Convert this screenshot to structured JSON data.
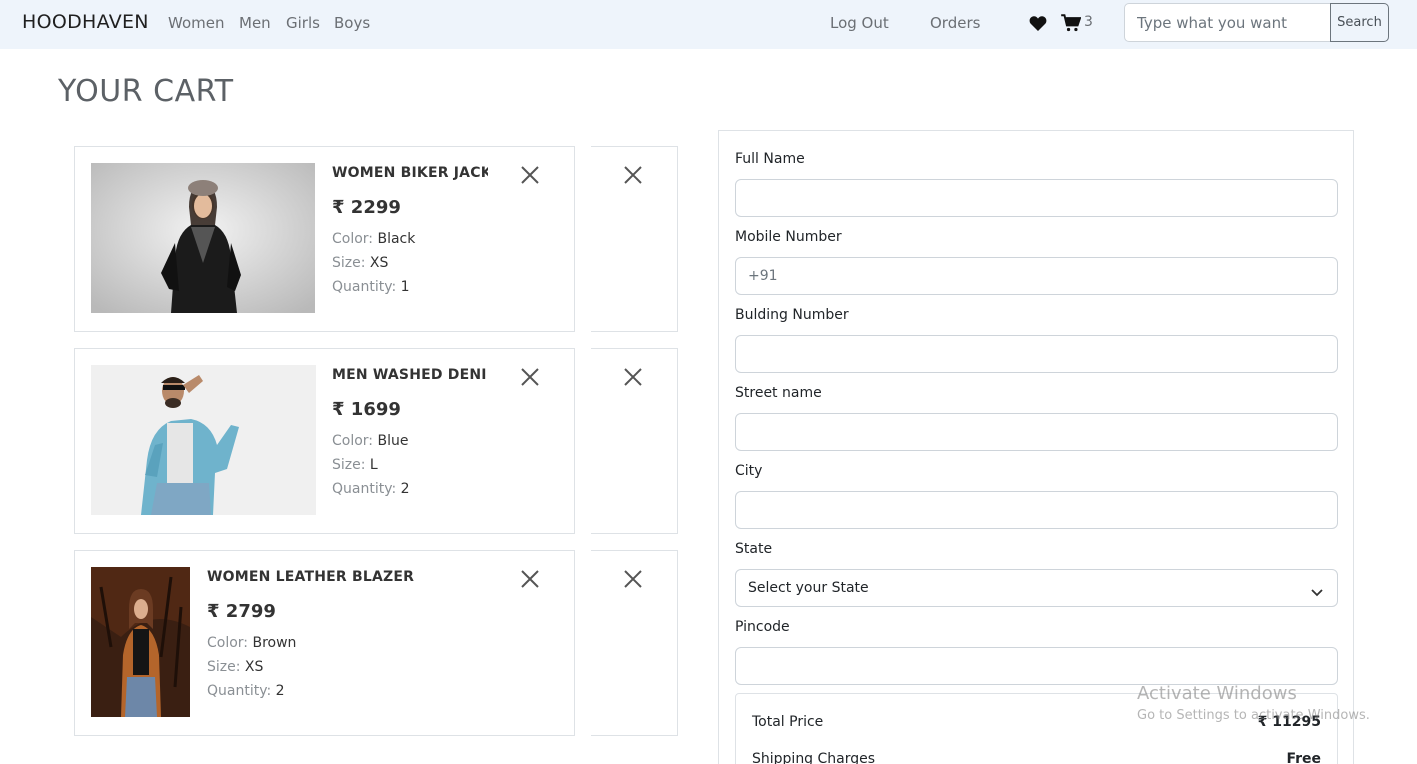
{
  "navbar": {
    "brand": "HOODHAVEN",
    "links": [
      "Women",
      "Men",
      "Girls",
      "Boys"
    ],
    "logout": "Log Out",
    "orders": "Orders",
    "cart_count": "3",
    "search_placeholder": "Type what you want",
    "search_button": "Search"
  },
  "page_title": "YOUR CART",
  "cart_items": [
    {
      "name": "WOMEN BIKER JACKE",
      "price": "₹ 2299",
      "color_label": "Color:",
      "color": "Black",
      "size_label": "Size:",
      "size": "XS",
      "quantity_label": "Quantity:",
      "quantity": "1"
    },
    {
      "name": "MEN WASHED DENIM",
      "price": "₹ 1699",
      "color_label": "Color:",
      "color": "Blue",
      "size_label": "Size:",
      "size": "L",
      "quantity_label": "Quantity:",
      "quantity": "2"
    },
    {
      "name": "WOMEN LEATHER BLAZER",
      "price": "₹ 2799",
      "color_label": "Color:",
      "color": "Brown",
      "size_label": "Size:",
      "size": "XS",
      "quantity_label": "Quantity:",
      "quantity": "2"
    }
  ],
  "form": {
    "full_name_label": "Full Name",
    "mobile_label": "Mobile Number",
    "mobile_placeholder": "+91",
    "building_label": "Bulding Number",
    "street_label": "Street name",
    "city_label": "City",
    "state_label": "State",
    "state_selected": "Select your State",
    "pincode_label": "Pincode"
  },
  "summary": {
    "total_label": "Total Price",
    "total_value": "₹ 11295",
    "shipping_label": "Shipping Charges",
    "shipping_value": "Free"
  },
  "watermark": {
    "title": "Activate Windows",
    "subtitle": "Go to Settings to activate Windows."
  },
  "colors": {
    "navbar_bg": "#eef4fb",
    "border": "#dee2e6",
    "muted_text": "#6b6f74"
  }
}
